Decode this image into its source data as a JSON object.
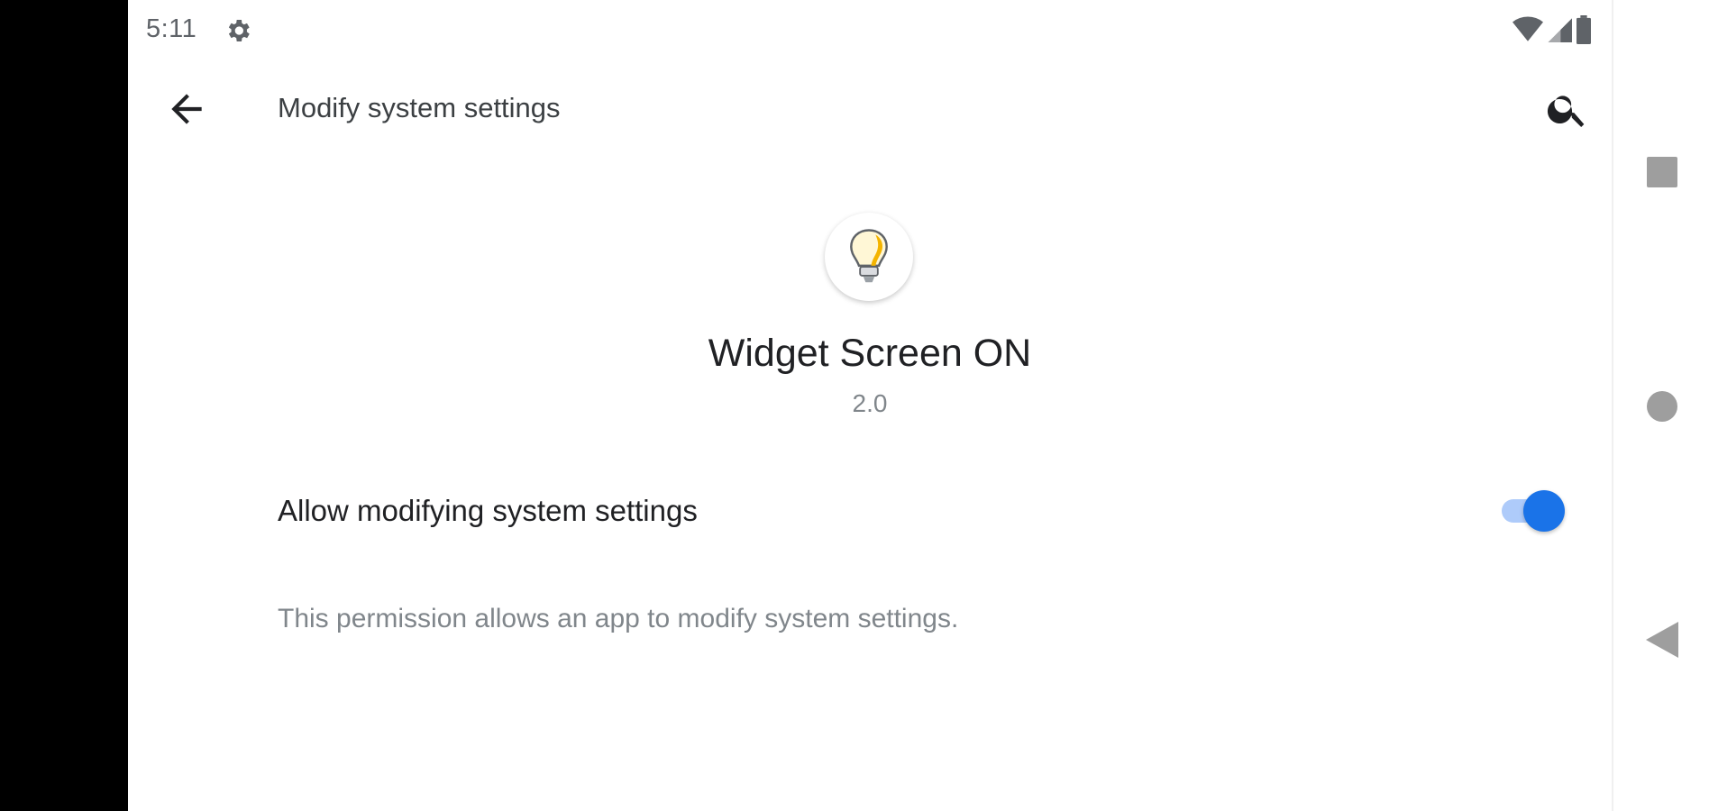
{
  "status_bar": {
    "time": "5:11",
    "icons": [
      "settings-gear-icon",
      "wifi-icon",
      "signal-icon",
      "battery-icon"
    ]
  },
  "app_bar": {
    "title": "Modify system settings",
    "back_icon": "arrow-back-icon",
    "search_icon": "search-icon"
  },
  "app": {
    "icon": "lightbulb-icon",
    "name": "Widget Screen ON",
    "version": "2.0"
  },
  "permission": {
    "toggle_label": "Allow modifying system settings",
    "toggle_on": true,
    "description": "This permission allows an app to modify system settings."
  },
  "colors": {
    "accent": "#1a73e8",
    "track": "#aecbfa"
  },
  "nav_bar": {
    "icons": [
      "recents-square-icon",
      "home-circle-icon",
      "back-triangle-icon"
    ]
  }
}
